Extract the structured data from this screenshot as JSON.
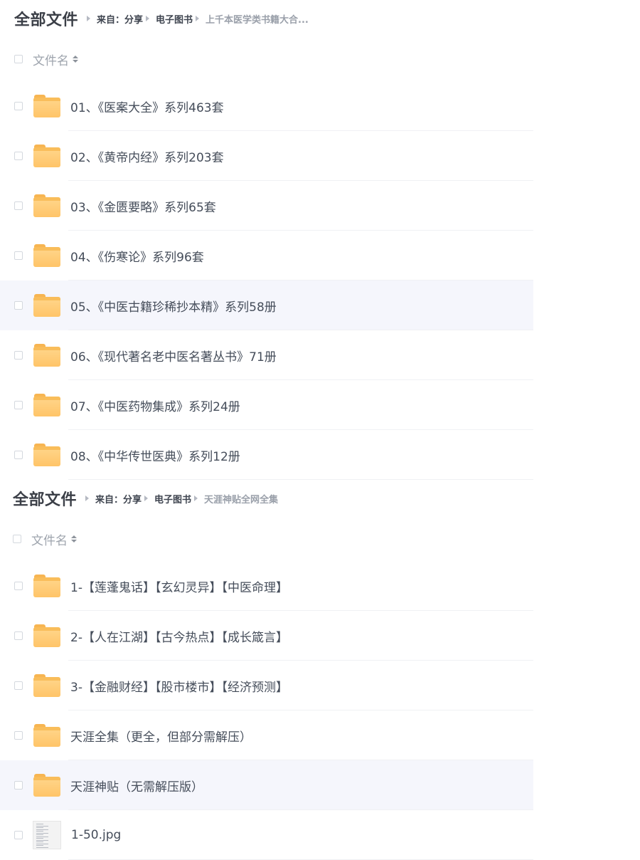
{
  "panel1": {
    "breadcrumb": {
      "title": "全部文件",
      "items": [
        "来自：分享",
        "电子图书",
        "上千本医学类书籍大合..."
      ]
    },
    "header": {
      "col_label": "文件名"
    },
    "rows": [
      {
        "name": "01、《医案大全》系列463套",
        "icon": "folder-icon"
      },
      {
        "name": "02、《黄帝内经》系列203套",
        "icon": "folder-icon"
      },
      {
        "name": "03、《金匮要略》系列65套",
        "icon": "folder-icon"
      },
      {
        "name": "04、《伤寒论》系列96套",
        "icon": "folder-icon"
      },
      {
        "name": "05、《中医古籍珍稀抄本精》系列58册",
        "icon": "folder-icon",
        "hover": true
      },
      {
        "name": "06、《现代著名老中医名著丛书》71册",
        "icon": "folder-icon"
      },
      {
        "name": "07、《中医药物集成》系列24册",
        "icon": "folder-icon"
      },
      {
        "name": "08、《中华传世医典》系列12册",
        "icon": "folder-icon"
      }
    ]
  },
  "panel2": {
    "breadcrumb": {
      "title": "全部文件",
      "items": [
        "来自：分享",
        "电子图书",
        "天涯神贴全网全集"
      ]
    },
    "header": {
      "col_label": "文件名"
    },
    "rows": [
      {
        "name": "1-【莲蓬鬼话】【玄幻灵异】【中医命理】",
        "icon": "folder-icon"
      },
      {
        "name": "2-【人在江湖】【古今热点】【成长箴言】",
        "icon": "folder-icon"
      },
      {
        "name": "3-【金融财经】【股市楼市】【经济预测】",
        "icon": "folder-icon"
      },
      {
        "name": "天涯全集（更全，但部分需解压）",
        "icon": "folder-icon"
      },
      {
        "name": "天涯神贴（无需解压版）",
        "icon": "folder-icon",
        "hover": true
      },
      {
        "name": "1-50.jpg",
        "icon": "image-file-icon"
      }
    ]
  }
}
